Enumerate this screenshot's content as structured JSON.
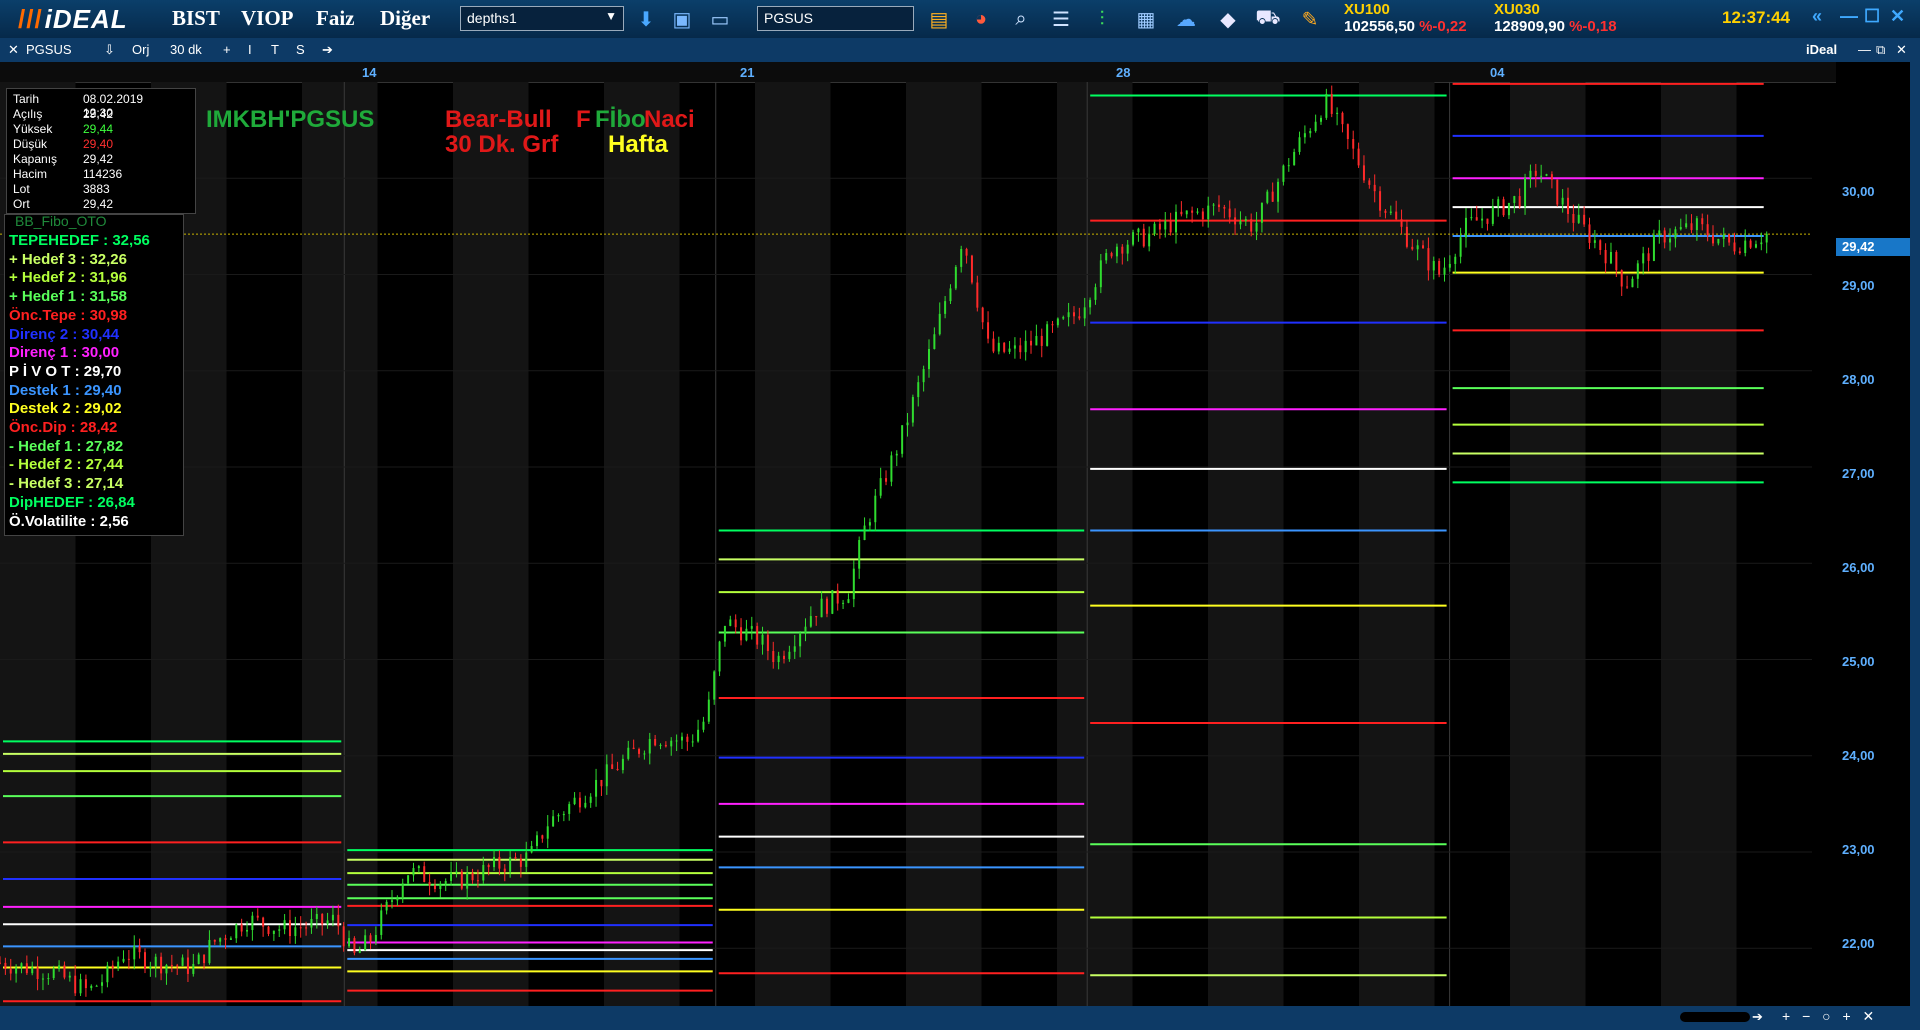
{
  "app": {
    "logo": "iDEAL"
  },
  "menu": [
    "BIST",
    "VIOP",
    "Faiz",
    "Diğer"
  ],
  "toolbar": {
    "layout_combo": "depths1",
    "symbol_input": "PGSUS",
    "icons": [
      "download-icon",
      "save-icon",
      "monitor-icon",
      "folder-icon",
      "pie-chart-icon",
      "search-icon",
      "list-icon",
      "candles-icon",
      "card-icon",
      "cloud-icon",
      "box-icon",
      "cart-icon",
      "brush-icon"
    ]
  },
  "indices": [
    {
      "name": "XU100",
      "value": "102556,50",
      "change": "%-0,22"
    },
    {
      "name": "XU030",
      "value": "128909,90",
      "change": "%-0,18"
    }
  ],
  "clock": "12:37:44",
  "window_buttons": [
    "«",
    "—",
    "☐",
    "✕"
  ],
  "subbar": {
    "symbol": "PGSUS",
    "items": [
      "⇩",
      "Orj",
      "30 dk",
      "+",
      "I",
      "T",
      "S",
      "➔"
    ],
    "brand": "iDeal",
    "controls": [
      "—",
      "⧉",
      "✕"
    ]
  },
  "time_labels": [
    "14",
    "21",
    "28",
    "04"
  ],
  "ohlc": [
    [
      "Tarih",
      "08.02.2019 12:30"
    ],
    [
      "Açılış",
      "29,42"
    ],
    [
      "Yüksek",
      "29,44"
    ],
    [
      "Düşük",
      "29,40"
    ],
    [
      "Kapanış",
      "29,42"
    ],
    [
      "Hacim",
      "114236"
    ],
    [
      "Lot",
      "3883"
    ],
    [
      "Ort",
      "29,42"
    ]
  ],
  "fibo_panel": {
    "title": "BB_Fibo_OTO",
    "rows": [
      {
        "label": "TEPEHEDEF :",
        "value": "32,56",
        "color": "#00ff60"
      },
      {
        "label": "+ Hedef 3 :",
        "value": "32,26",
        "color": "#c8ff64"
      },
      {
        "label": "+ Hedef 2 :",
        "value": "31,96",
        "color": "#b4ff3c"
      },
      {
        "label": "+ Hedef 1 :",
        "value": "31,58",
        "color": "#5aff5a"
      },
      {
        "label": "Önc.Tepe :",
        "value": "30,98",
        "color": "#ff2020"
      },
      {
        "label": "Direnç 2  :",
        "value": "30,44",
        "color": "#2030ff"
      },
      {
        "label": "Direnç 1  :",
        "value": "30,00",
        "color": "#ff20ff"
      },
      {
        "label": "P İ V O T :",
        "value": "29,70",
        "color": "#ffffff"
      },
      {
        "label": "Destek 1  :",
        "value": "29,40",
        "color": "#3b95ff"
      },
      {
        "label": "Destek 2  :",
        "value": "29,02",
        "color": "#ffff20"
      },
      {
        "label": "Önc.Dip  :",
        "value": "28,42",
        "color": "#ff2020"
      },
      {
        "label": "- Hedef 1  :",
        "value": "27,82",
        "color": "#5aff5a"
      },
      {
        "label": "- Hedef 2  :",
        "value": "27,44",
        "color": "#b4ff3c"
      },
      {
        "label": "- Hedef 3  :",
        "value": "27,14",
        "color": "#c8ff64"
      },
      {
        "label": "DipHEDEF :",
        "value": "26,84",
        "color": "#00ff60"
      },
      {
        "label": "Ö.Volatilite :",
        "value": "2,56",
        "color": "#ffffff"
      }
    ]
  },
  "chart_titles": {
    "symbol": "IMKBH'PGSUS",
    "bear_bull": "Bear-Bull",
    "fibo": "Fİbo",
    "naci": "Naci",
    "interval": "30 Dk. Grf",
    "period": "Hafta"
  },
  "chart_data": {
    "type": "candlestick",
    "symbol": "PGSUS",
    "interval": "30 dk",
    "x_labels": [
      "14",
      "21",
      "28",
      "04"
    ],
    "ylim": [
      21.4,
      31.0
    ],
    "y_ticks": [
      "30,00",
      "29,00",
      "28,00",
      "27,00",
      "26,00",
      "25,00",
      "24,00",
      "23,00",
      "22,00"
    ],
    "current_price": "29,42",
    "price_path": [
      [
        0.0,
        21.85
      ],
      [
        0.03,
        21.75
      ],
      [
        0.05,
        21.55
      ],
      [
        0.06,
        21.7
      ],
      [
        0.07,
        21.95
      ],
      [
        0.09,
        21.85
      ],
      [
        0.11,
        21.8
      ],
      [
        0.12,
        22.05
      ],
      [
        0.14,
        22.3
      ],
      [
        0.16,
        22.2
      ],
      [
        0.18,
        22.25
      ],
      [
        0.19,
        22.3
      ],
      [
        0.2,
        21.9
      ],
      [
        0.21,
        22.1
      ],
      [
        0.23,
        22.8
      ],
      [
        0.25,
        22.7
      ],
      [
        0.26,
        22.7
      ],
      [
        0.28,
        22.85
      ],
      [
        0.3,
        22.95
      ],
      [
        0.31,
        23.3
      ],
      [
        0.33,
        23.6
      ],
      [
        0.35,
        23.9
      ],
      [
        0.37,
        24.2
      ],
      [
        0.39,
        24.15
      ],
      [
        0.4,
        24.4
      ],
      [
        0.41,
        25.4
      ],
      [
        0.43,
        25.2
      ],
      [
        0.44,
        25.0
      ],
      [
        0.46,
        25.5
      ],
      [
        0.48,
        25.7
      ],
      [
        0.49,
        26.4
      ],
      [
        0.51,
        27.3
      ],
      [
        0.53,
        28.4
      ],
      [
        0.545,
        29.4
      ],
      [
        0.56,
        28.2
      ],
      [
        0.575,
        28.2
      ],
      [
        0.595,
        28.4
      ],
      [
        0.61,
        28.6
      ],
      [
        0.63,
        29.3
      ],
      [
        0.65,
        29.4
      ],
      [
        0.67,
        29.6
      ],
      [
        0.69,
        29.7
      ],
      [
        0.71,
        29.5
      ],
      [
        0.73,
        30.2
      ],
      [
        0.75,
        30.8
      ],
      [
        0.765,
        30.3
      ],
      [
        0.78,
        29.8
      ],
      [
        0.8,
        29.3
      ],
      [
        0.815,
        29.0
      ],
      [
        0.83,
        29.5
      ],
      [
        0.86,
        29.8
      ],
      [
        0.87,
        30.1
      ],
      [
        0.89,
        29.6
      ],
      [
        0.91,
        29.2
      ],
      [
        0.92,
        28.9
      ],
      [
        0.94,
        29.4
      ],
      [
        0.96,
        29.5
      ],
      [
        0.98,
        29.3
      ],
      [
        1.0,
        29.42
      ]
    ],
    "levels": [
      {
        "segment": [
          0.0,
          0.19
        ],
        "values": [
          {
            "name": "TEPEHEDEF",
            "value": 24.15,
            "color": "#00ff60"
          },
          {
            "name": "+ Hedef 3",
            "value": 24.02,
            "color": "#c8ff64"
          },
          {
            "name": "+ Hedef 2",
            "value": 23.84,
            "color": "#b4ff3c"
          },
          {
            "name": "+ Hedef 1",
            "value": 23.58,
            "color": "#5aff5a"
          },
          {
            "name": "Önc.Tepe",
            "value": 23.1,
            "color": "#ff2020"
          },
          {
            "name": "Direnç 2",
            "value": 22.72,
            "color": "#2030ff"
          },
          {
            "name": "Direnç 1",
            "value": 22.43,
            "color": "#ff20ff"
          },
          {
            "name": "PİVOT",
            "value": 22.25,
            "color": "#ffffff"
          },
          {
            "name": "Destek 1",
            "value": 22.02,
            "color": "#3b95ff"
          },
          {
            "name": "Destek 2",
            "value": 21.8,
            "color": "#ffff20"
          },
          {
            "name": "Önc.Dip",
            "value": 21.45,
            "color": "#ff2020"
          }
        ]
      },
      {
        "segment": [
          0.19,
          0.395
        ],
        "values": [
          {
            "name": "TEPEHEDEF",
            "value": 23.02,
            "color": "#00ff60"
          },
          {
            "name": "+ Hedef 3",
            "value": 22.92,
            "color": "#c8ff64"
          },
          {
            "name": "+ Hedef 2",
            "value": 22.78,
            "color": "#b4ff3c"
          },
          {
            "name": "+ Hedef 1",
            "value": 22.66,
            "color": "#5aff5a"
          },
          {
            "name": "+ Hedef 1b",
            "value": 22.52,
            "color": "#5aff5a"
          },
          {
            "name": "Önc.Tepe",
            "value": 22.44,
            "color": "#ff2020"
          },
          {
            "name": "Direnç 2",
            "value": 22.24,
            "color": "#2030ff"
          },
          {
            "name": "Direnç 1",
            "value": 22.06,
            "color": "#ff20ff"
          },
          {
            "name": "PİVOT",
            "value": 21.98,
            "color": "#ffffff"
          },
          {
            "name": "Destek 1",
            "value": 21.89,
            "color": "#3b95ff"
          },
          {
            "name": "Destek 2",
            "value": 21.76,
            "color": "#ffff20"
          },
          {
            "name": "Önc.Dip",
            "value": 21.56,
            "color": "#ff2020"
          }
        ]
      },
      {
        "segment": [
          0.395,
          0.6
        ],
        "values": [
          {
            "name": "TEPEHEDEF",
            "value": 26.34,
            "color": "#00ff60"
          },
          {
            "name": "+ Hedef 3",
            "value": 26.04,
            "color": "#c8ff64"
          },
          {
            "name": "+ Hedef 2",
            "value": 25.7,
            "color": "#b4ff3c"
          },
          {
            "name": "+ Hedef 1",
            "value": 25.28,
            "color": "#5aff5a"
          },
          {
            "name": "Önc.Tepe",
            "value": 24.6,
            "color": "#ff2020"
          },
          {
            "name": "Direnç 2",
            "value": 23.98,
            "color": "#2030ff"
          },
          {
            "name": "Direnç 1",
            "value": 23.5,
            "color": "#ff20ff"
          },
          {
            "name": "PİVOT",
            "value": 23.16,
            "color": "#ffffff"
          },
          {
            "name": "Destek 1",
            "value": 22.84,
            "color": "#3b95ff"
          },
          {
            "name": "Destek 2",
            "value": 22.4,
            "color": "#ffff20"
          },
          {
            "name": "Önc.Dip",
            "value": 21.74,
            "color": "#ff2020"
          }
        ]
      },
      {
        "segment": [
          0.6,
          0.8
        ],
        "values": [
          {
            "name": "TEPEHEDEF",
            "value": 30.86,
            "color": "#00ff60"
          },
          {
            "name": "Önc.Tepe",
            "value": 29.56,
            "color": "#ff2020"
          },
          {
            "name": "Direnç 2",
            "value": 28.5,
            "color": "#2030ff"
          },
          {
            "name": "Direnç 1",
            "value": 27.6,
            "color": "#ff20ff"
          },
          {
            "name": "PİVOT",
            "value": 26.98,
            "color": "#ffffff"
          },
          {
            "name": "Destek 1",
            "value": 26.34,
            "color": "#3b95ff"
          },
          {
            "name": "Destek 2",
            "value": 25.56,
            "color": "#ffff20"
          },
          {
            "name": "Önc.Dip",
            "value": 24.34,
            "color": "#ff2020"
          },
          {
            "name": "- Hedef 1",
            "value": 23.08,
            "color": "#5aff5a"
          },
          {
            "name": "- Hedef 2",
            "value": 22.32,
            "color": "#b4ff3c"
          },
          {
            "name": "- Hedef 3",
            "value": 21.72,
            "color": "#c8ff64"
          }
        ]
      },
      {
        "segment": [
          0.8,
          0.975
        ],
        "values": [
          {
            "name": "TEPEHEDEF",
            "value": 32.56,
            "color": "#00ff60"
          },
          {
            "name": "+ Hedef 3",
            "value": 32.26,
            "color": "#c8ff64"
          },
          {
            "name": "+ Hedef 2",
            "value": 31.96,
            "color": "#b4ff3c"
          },
          {
            "name": "+ Hedef 1",
            "value": 31.58,
            "color": "#5aff5a"
          },
          {
            "name": "Önc.Tepe",
            "value": 30.98,
            "color": "#ff2020"
          },
          {
            "name": "Direnç 2",
            "value": 30.44,
            "color": "#2030ff"
          },
          {
            "name": "Direnç 1",
            "value": 30.0,
            "color": "#ff20ff"
          },
          {
            "name": "PİVOT",
            "value": 29.7,
            "color": "#ffffff"
          },
          {
            "name": "Destek 1",
            "value": 29.4,
            "color": "#3b95ff"
          },
          {
            "name": "Destek 2",
            "value": 29.02,
            "color": "#ffff20"
          },
          {
            "name": "Önc.Dip",
            "value": 28.42,
            "color": "#ff2020"
          },
          {
            "name": "- Hedef 1",
            "value": 27.82,
            "color": "#5aff5a"
          },
          {
            "name": "- Hedef 2",
            "value": 27.44,
            "color": "#b4ff3c"
          },
          {
            "name": "- Hedef 3",
            "value": 27.14,
            "color": "#c8ff64"
          },
          {
            "name": "DipHEDEF",
            "value": 26.84,
            "color": "#00ff60"
          }
        ]
      }
    ]
  }
}
